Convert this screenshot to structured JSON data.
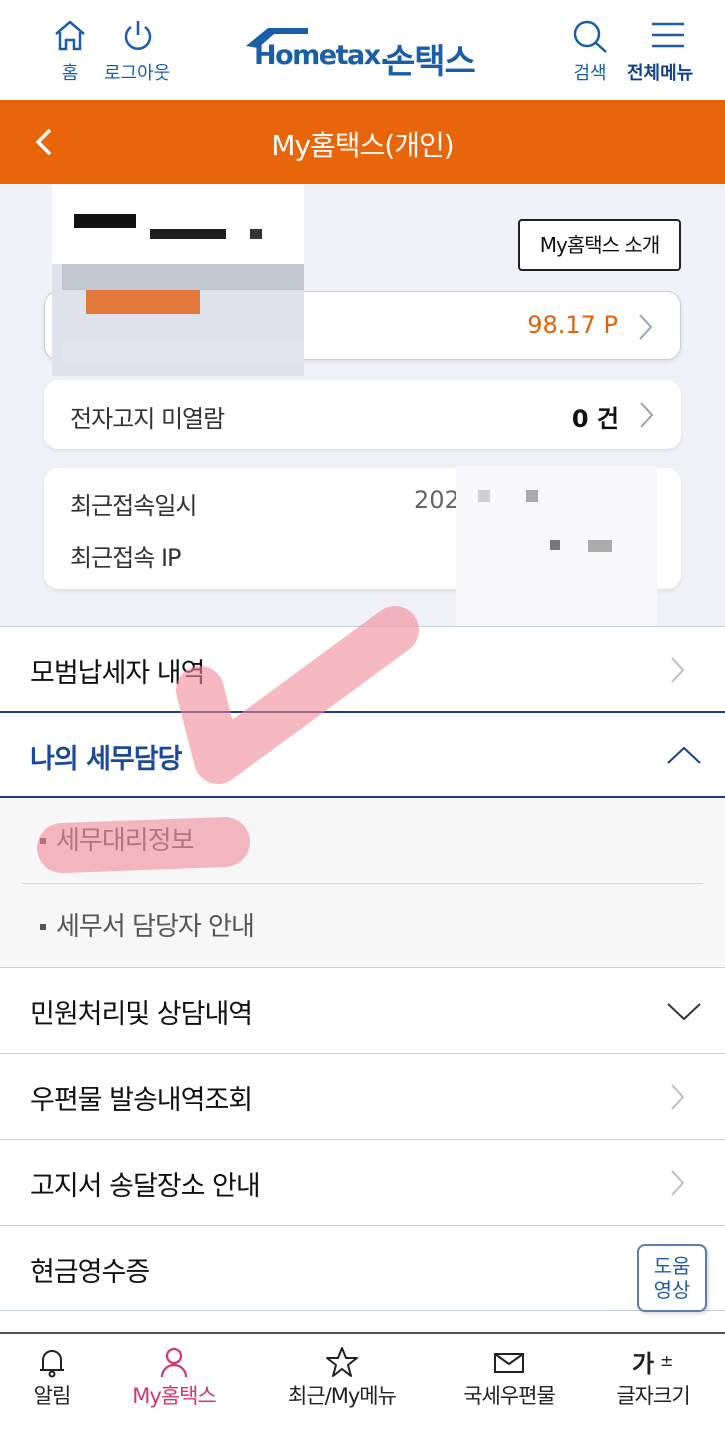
{
  "header": {
    "home_label": "홈",
    "logout_label": "로그아웃",
    "logo_en": "Hometax.",
    "logo_ko": "손택스",
    "search_label": "검색",
    "menu_label": "전체메뉴"
  },
  "titlebar": {
    "title": "My홈택스(개인)"
  },
  "profile": {
    "intro_button": "My홈택스 소개",
    "points_value": "98.17 P",
    "unread_label": "전자고지 미열람",
    "unread_value": "0 건",
    "last_access_label": "최근접속일시",
    "last_access_value": "202",
    "last_ip_label": "최근접속 IP"
  },
  "menu": {
    "items": [
      {
        "label": "모범납세자 내역"
      },
      {
        "label": "나의 세무담당"
      },
      {
        "label": "민원처리및 상담내역"
      },
      {
        "label": "우편물 발송내역조회"
      },
      {
        "label": "고지서 송달장소 안내"
      },
      {
        "label": "현금영수증"
      }
    ],
    "sub_items": [
      {
        "label": "세무대리정보"
      },
      {
        "label": "세무서 담당자 안내"
      }
    ]
  },
  "help_button": {
    "line1": "도움",
    "line2": "영상"
  },
  "bottom_nav": [
    {
      "label": "알림"
    },
    {
      "label": "My홈택스"
    },
    {
      "label": "최근/My메뉴"
    },
    {
      "label": "국세우편물"
    },
    {
      "label": "글자크기"
    }
  ],
  "colors": {
    "brand_orange": "#e8650a",
    "brand_blue": "#1a5ea8",
    "active_nav": "#d3376a",
    "annotation": "#f08a98"
  }
}
